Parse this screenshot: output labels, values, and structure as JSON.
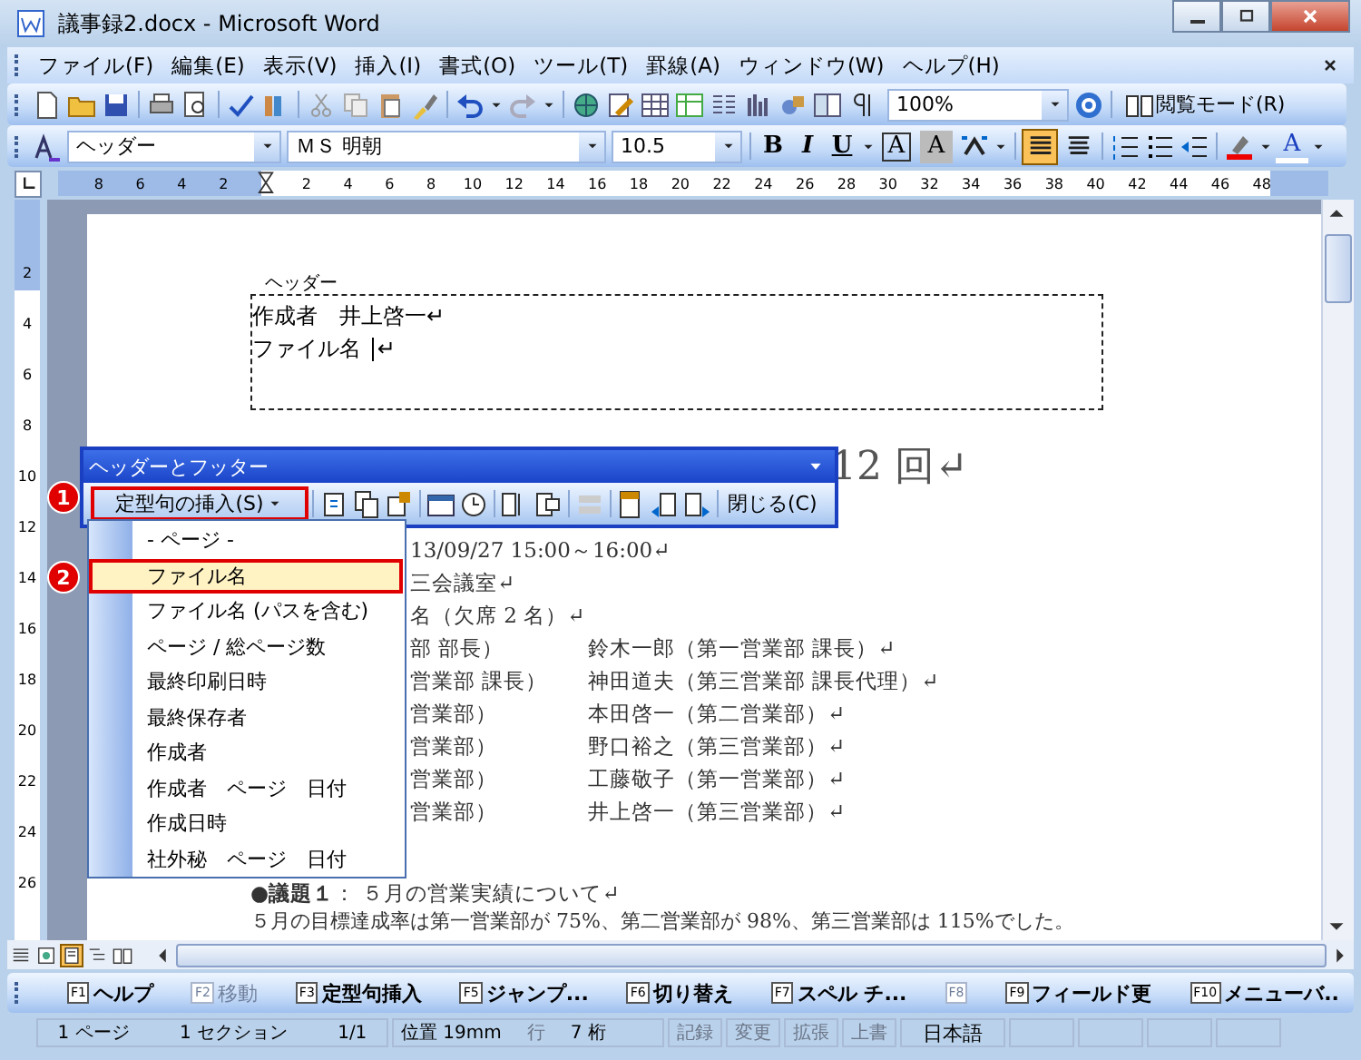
{
  "window": {
    "title": "議事録2.docx - Microsoft Word"
  },
  "menu_bar": {
    "items": [
      "ファイル(F)",
      "編集(E)",
      "表示(V)",
      "挿入(I)",
      "書式(O)",
      "ツール(T)",
      "罫線(A)",
      "ウィンドウ(W)",
      "ヘルプ(H)"
    ]
  },
  "standard_toolbar": {
    "zoom": "100%",
    "reading_mode": "閲覧モード(R)"
  },
  "format_toolbar": {
    "style": "ヘッダー",
    "font": "ＭＳ 明朝",
    "size": "10.5",
    "bold": "B",
    "italic": "I",
    "underline": "U",
    "border_char": "A",
    "shading_char": "A",
    "font_color_char": "A",
    "align_buttons": [
      {
        "selected": true
      },
      {
        "selected": false
      }
    ]
  },
  "ruler": {
    "left_numbers": [
      "8",
      "6",
      "4",
      "2"
    ],
    "right_numbers": [
      "2",
      "4",
      "6",
      "8",
      "10",
      "12",
      "14",
      "16",
      "18",
      "20",
      "22",
      "24",
      "26",
      "28",
      "30",
      "32",
      "34",
      "36",
      "38",
      "40",
      "42",
      "44",
      "46",
      "48"
    ]
  },
  "vertical_ruler": {
    "numbers": [
      "2",
      "4",
      "6",
      "8",
      "10",
      "12",
      "14",
      "16",
      "18",
      "20",
      "22",
      "24",
      "26"
    ]
  },
  "document": {
    "header_label": "ヘッダー",
    "header_lines": [
      {
        "text": "作成者　井上啓一",
        "cursor": false,
        "end": "↵"
      },
      {
        "text": "ファイル名 ",
        "cursor": true,
        "end": "↵"
      }
    ],
    "title_fragment": "12 回↵",
    "rows": [
      {
        "left": "13/09/27 15:00～16:00↵"
      },
      {
        "left": "三会議室↵"
      },
      {
        "left": "名（欠席 2 名）↵"
      },
      {
        "left": "部 部長）",
        "right": "鈴木一郎（第一営業部 課長）↵"
      },
      {
        "left": "営業部 課長）",
        "right": "神田道夫（第三営業部 課長代理）↵"
      },
      {
        "left": "営業部）",
        "right": "本田啓一（第二営業部）↵"
      },
      {
        "left": "営業部）",
        "right": "野口裕之（第三営業部）↵"
      },
      {
        "left": "営業部）",
        "right": "工藤敬子（第一営業部）↵"
      },
      {
        "left": "営業部）",
        "right": "井上啓一（第三営業部）↵"
      }
    ],
    "agenda": "●**議題１**： ５月の営業実績について↵",
    "paragraph": "５月の目標達成率は第一営業部が 75%、第二営業部が 98%、第三営業部は 115%でした。"
  },
  "header_footer_toolbar": {
    "title": "ヘッダーとフッター",
    "insert_button": "定型句の挿入(S)",
    "close_button": "閉じる(C)"
  },
  "insert_menu": {
    "items": [
      {
        "label": "- ページ -",
        "selected": false
      },
      {
        "label": "ファイル名",
        "selected": true
      },
      {
        "label": "ファイル名 (パスを含む)",
        "selected": false
      },
      {
        "label": "ページ / 総ページ数",
        "selected": false
      },
      {
        "label": "最終印刷日時",
        "selected": false
      },
      {
        "label": "最終保存者",
        "selected": false
      },
      {
        "label": "作成者",
        "selected": false
      },
      {
        "label": "作成者　ページ　日付",
        "selected": false
      },
      {
        "label": "作成日時",
        "selected": false
      },
      {
        "label": "社外秘　ページ　日付",
        "selected": false
      }
    ]
  },
  "callouts": [
    "1",
    "2"
  ],
  "view_buttons": [
    {
      "selected": false
    },
    {
      "selected": false
    },
    {
      "selected": true
    },
    {
      "selected": false
    },
    {
      "selected": false
    }
  ],
  "function_keys": [
    {
      "key": "F1",
      "label": "ヘルプ",
      "disabled": false
    },
    {
      "key": "F2",
      "label": "移動",
      "disabled": true
    },
    {
      "key": "F3",
      "label": "定型句挿入",
      "disabled": false
    },
    {
      "key": "F5",
      "label": "ジャンプ...",
      "disabled": false
    },
    {
      "key": "F6",
      "label": "切り替え",
      "disabled": false
    },
    {
      "key": "F7",
      "label": "スペル チ...",
      "disabled": false
    },
    {
      "key": "F8",
      "disabled": true
    },
    {
      "key": "F9",
      "label": "フィールド更",
      "disabled": false
    },
    {
      "key": "F10",
      "label": "メニューバ..",
      "disabled": false
    }
  ],
  "status_bar": {
    "cells": [
      {
        "items": [
          {
            "text": "1 ページ",
            "disabled": false
          },
          {
            "text": "1 セクション",
            "disabled": false
          },
          {
            "text": "1/1",
            "disabled": false
          }
        ]
      },
      {
        "items": [
          {
            "text": "位置 19mm",
            "disabled": false
          },
          {
            "text": "行",
            "disabled": true
          },
          {
            "text": "7 桁",
            "disabled": false
          }
        ]
      },
      {
        "items": [
          {
            "text": "記録",
            "disabled": true
          }
        ]
      },
      {
        "items": [
          {
            "text": "変更",
            "disabled": true
          }
        ]
      },
      {
        "items": [
          {
            "text": "拡張",
            "disabled": true
          }
        ]
      },
      {
        "items": [
          {
            "text": "上書",
            "disabled": true
          }
        ]
      },
      {
        "items": [
          {
            "text": "日本語",
            "disabled": false
          }
        ]
      }
    ]
  }
}
